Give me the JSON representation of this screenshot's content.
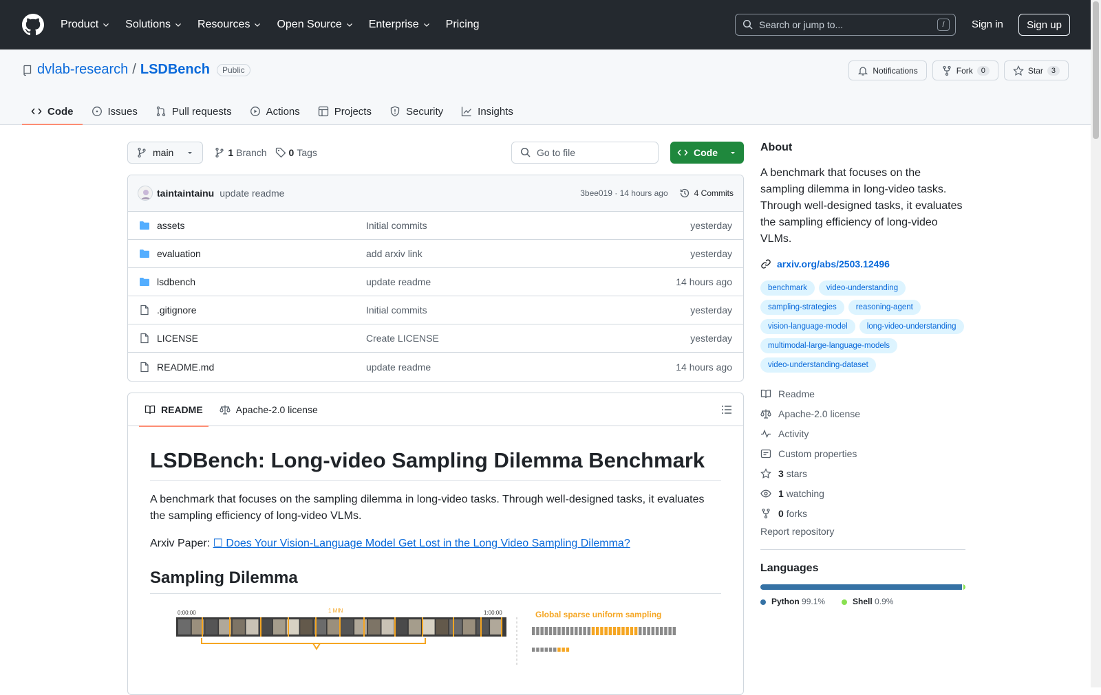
{
  "header": {
    "nav": [
      "Product",
      "Solutions",
      "Resources",
      "Open Source",
      "Enterprise",
      "Pricing"
    ],
    "search_placeholder": "Search or jump to...",
    "search_shortcut": "/",
    "signin": "Sign in",
    "signup": "Sign up"
  },
  "repo": {
    "owner": "dvlab-research",
    "sep": "/",
    "name": "LSDBench",
    "visibility": "Public",
    "notifications": "Notifications",
    "fork_label": "Fork",
    "fork_count": "0",
    "star_label": "Star",
    "star_count": "3",
    "tabs": [
      "Code",
      "Issues",
      "Pull requests",
      "Actions",
      "Projects",
      "Security",
      "Insights"
    ]
  },
  "toolbar": {
    "branch": "main",
    "branch_count": "1",
    "branch_label": "Branch",
    "tag_count": "0",
    "tag_label": "Tags",
    "goto_placeholder": "Go to file",
    "code_label": "Code"
  },
  "commit": {
    "author": "taintaintainu",
    "message": "update readme",
    "meta": "3bee019 · 14 hours ago",
    "commits": "4 Commits"
  },
  "files": [
    {
      "name": "assets",
      "type": "folder",
      "msg": "Initial commits",
      "time": "yesterday"
    },
    {
      "name": "evaluation",
      "type": "folder",
      "msg": "add arxiv link",
      "time": "yesterday"
    },
    {
      "name": "lsdbench",
      "type": "folder",
      "msg": "update readme",
      "time": "14 hours ago"
    },
    {
      "name": ".gitignore",
      "type": "file",
      "msg": "Initial commits",
      "time": "yesterday"
    },
    {
      "name": "LICENSE",
      "type": "file",
      "msg": "Create LICENSE",
      "time": "yesterday"
    },
    {
      "name": "README.md",
      "type": "file",
      "msg": "update readme",
      "time": "14 hours ago"
    }
  ],
  "readme": {
    "tab_readme": "README",
    "tab_license": "Apache-2.0 license",
    "title": "LSDBench: Long-video Sampling Dilemma Benchmark",
    "intro": "A benchmark that focuses on the sampling dilemma in long-video tasks. Through well-designed tasks, it evaluates the sampling efficiency of long-video VLMs.",
    "paper_prefix": "Arxiv Paper: ",
    "paper_link": "☐ Does Your Vision-Language Model Get Lost in the Long Video Sampling Dilemma?",
    "section": "Sampling Dilemma",
    "fig_start": "0:00:00",
    "fig_mark": "1 MIN",
    "fig_end": "1:00:00",
    "fig_caption": "Global sparse uniform sampling"
  },
  "about": {
    "heading": "About",
    "desc": "A benchmark that focuses on the sampling dilemma in long-video tasks. Through well-designed tasks, it evaluates the sampling efficiency of long-video VLMs.",
    "link": "arxiv.org/abs/2503.12496",
    "topics": [
      "benchmark",
      "video-understanding",
      "sampling-strategies",
      "reasoning-agent",
      "vision-language-model",
      "long-video-understanding",
      "multimodal-large-language-models",
      "video-understanding-dataset"
    ],
    "readme": "Readme",
    "license": "Apache-2.0 license",
    "activity": "Activity",
    "custom": "Custom properties",
    "stars_n": "3",
    "stars": "stars",
    "watch_n": "1",
    "watch": "watching",
    "forks_n": "0",
    "forks": "forks",
    "report": "Report repository"
  },
  "languages": {
    "heading": "Languages",
    "items": [
      {
        "name": "Python",
        "pct": "99.1%",
        "value": 99.1,
        "color": "#3572A5"
      },
      {
        "name": "Shell",
        "pct": "0.9%",
        "value": 0.9,
        "color": "#89e051"
      }
    ]
  }
}
